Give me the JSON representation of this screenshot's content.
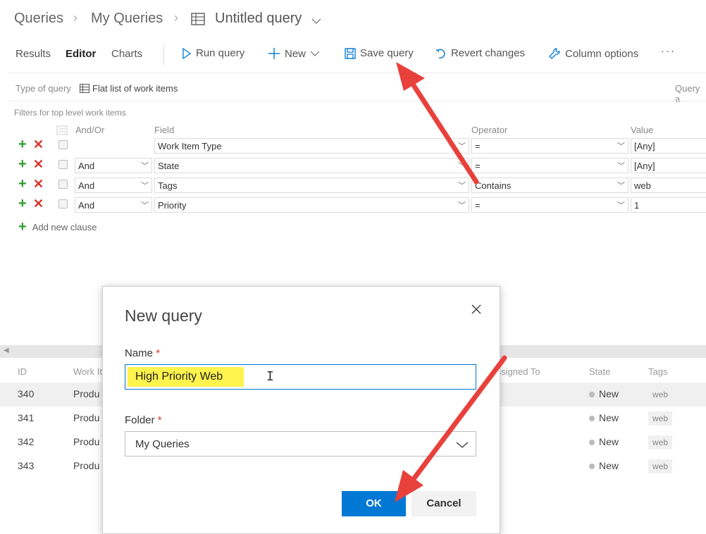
{
  "breadcrumb": {
    "root": "Queries",
    "folder": "My Queries",
    "current": "Untitled query"
  },
  "tabs": [
    {
      "label": "Results"
    },
    {
      "label": "Editor"
    },
    {
      "label": "Charts"
    }
  ],
  "toolbar": {
    "run": "Run query",
    "new": "New",
    "save": "Save query",
    "revert": "Revert changes",
    "columns": "Column options",
    "more": "···"
  },
  "query_bar": {
    "type_label": "Type of query",
    "type_value": "Flat list of work items",
    "right_label": "Query a"
  },
  "filters": {
    "title": "Filters for top level work items",
    "headers": {
      "andor": "And/Or",
      "field": "Field",
      "operator": "Operator",
      "value": "Value"
    },
    "rows": [
      {
        "andor": "",
        "field": "Work Item Type",
        "operator": "=",
        "value": "[Any]"
      },
      {
        "andor": "And",
        "field": "State",
        "operator": "=",
        "value": "[Any]"
      },
      {
        "andor": "And",
        "field": "Tags",
        "operator": "Contains",
        "value": "web"
      },
      {
        "andor": "And",
        "field": "Priority",
        "operator": "=",
        "value": "1"
      }
    ],
    "add_clause": "Add new clause"
  },
  "results": {
    "headers": {
      "id": "ID",
      "work": "Work It",
      "assigned": "Assigned To",
      "state": "State",
      "tags": "Tags"
    },
    "rows": [
      {
        "id": "340",
        "work": "Produ",
        "state": "New",
        "tag": "web"
      },
      {
        "id": "341",
        "work": "Produ",
        "state": "New",
        "tag": "web"
      },
      {
        "id": "342",
        "work": "Produ",
        "state": "New",
        "tag": "web"
      },
      {
        "id": "343",
        "work": "Produ",
        "state": "New",
        "tag": "web"
      }
    ]
  },
  "dialog": {
    "title": "New query",
    "name_label": "Name",
    "required_mark": "*",
    "name_value": "High Priority Web",
    "folder_label": "Folder",
    "folder_value": "My Queries",
    "ok": "OK",
    "cancel": "Cancel"
  },
  "colors": {
    "accent": "#0078d4",
    "arrow": "#e8413c",
    "highlight": "#fff34d",
    "add_green": "#2e9d2e",
    "remove_red": "#d9342b"
  }
}
